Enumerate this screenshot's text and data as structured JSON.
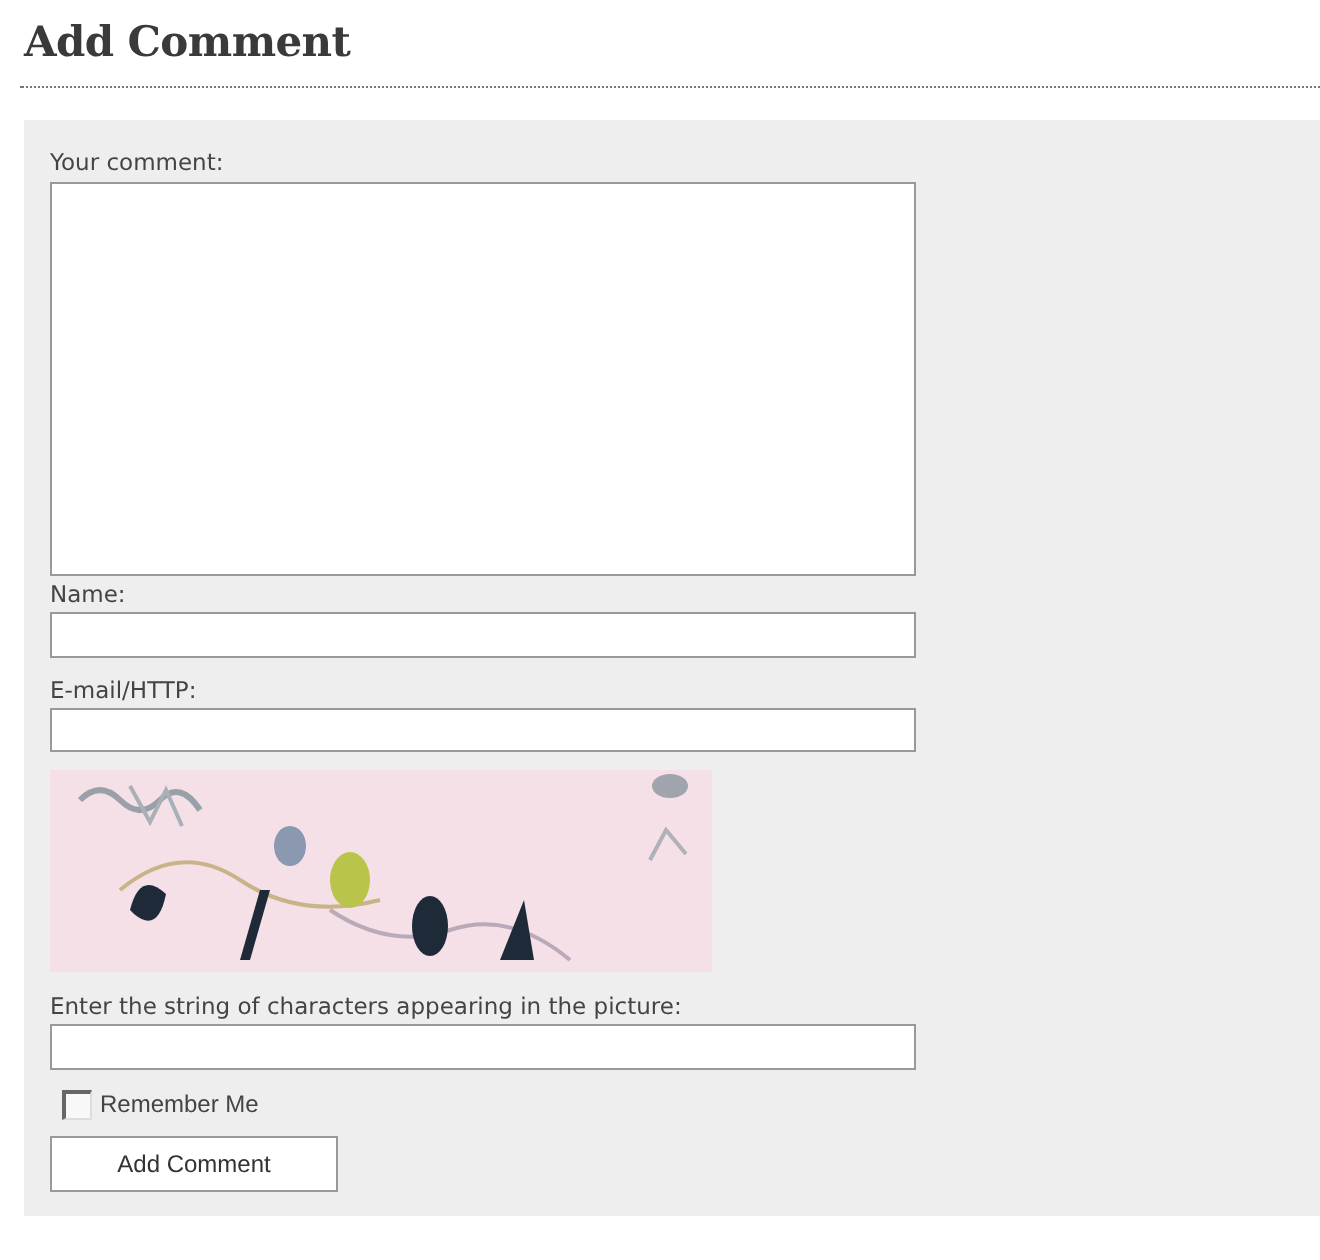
{
  "heading": "Add Comment",
  "form": {
    "items": [
      {
        "kind": "textarea",
        "label": "Your comment:"
      },
      {
        "kind": "text",
        "label": "Name:"
      },
      {
        "kind": "text",
        "label": "E-mail/HTTP:"
      },
      {
        "kind": "picture"
      },
      {
        "kind": "text",
        "label": "Enter the string of characters appearing in the picture:"
      },
      {
        "kind": "checkbox",
        "label": "Remember Me",
        "checked": false
      },
      {
        "kind": "button",
        "label": "Add Comment"
      }
    ]
  }
}
